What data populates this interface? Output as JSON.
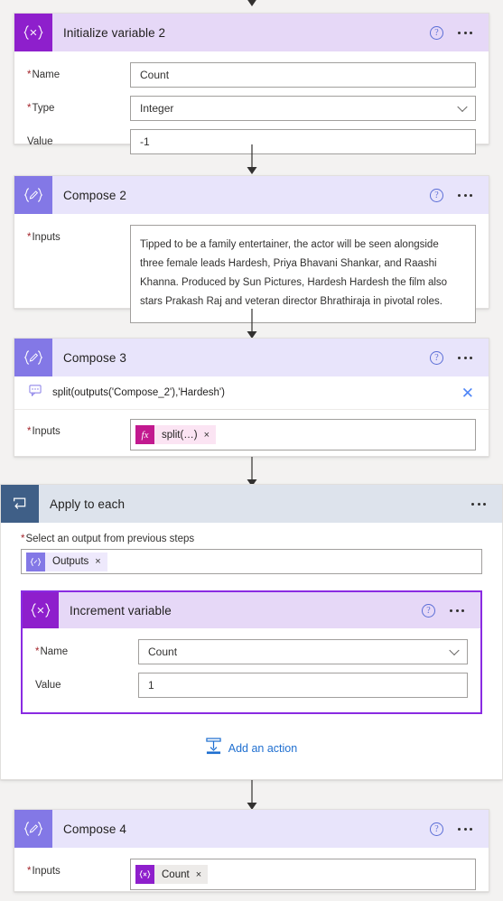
{
  "theme": {
    "bg": "#f3f2f1",
    "variable_purple": "#8e1fcc",
    "compose_purple": "#8378e6",
    "loop_blue": "#3f5f87",
    "accent_link": "#1f6fd0",
    "selected_border": "#8a2be2",
    "required_red": "#a4262c"
  },
  "steps": {
    "initialize_variable": {
      "title": "Initialize variable 2",
      "icon": "variable-icon",
      "fields": [
        {
          "label": "Name",
          "required": true,
          "value": "Count",
          "type": "text"
        },
        {
          "label": "Type",
          "required": true,
          "value": "Integer",
          "type": "dropdown"
        },
        {
          "label": "Value",
          "required": false,
          "value": "-1",
          "type": "text"
        }
      ]
    },
    "compose_2": {
      "title": "Compose 2",
      "icon": "compose-icon",
      "inputs_label": "Inputs",
      "inputs_required": true,
      "inputs_value": "Tipped to be a family entertainer, the actor will be seen alongside three female leads Hardesh, Priya Bhavani Shankar, and Raashi Khanna. Produced by Sun Pictures, Hardesh Hardesh the film also stars Prakash Raj and veteran director Bhrathiraja in pivotal roles."
    },
    "compose_3": {
      "title": "Compose 3",
      "icon": "compose-icon",
      "expression": "split(outputs('Compose_2'),'Hardesh')",
      "expression_icon": "tooltip-icon",
      "close_label": "✕",
      "inputs_label": "Inputs",
      "inputs_required": true,
      "token": {
        "tile": "fx",
        "label": "split(…)",
        "remove": "×"
      }
    },
    "apply_to_each": {
      "title": "Apply to each",
      "icon": "loop-icon",
      "select_label": "Select an output from previous steps",
      "select_required": true,
      "token": {
        "tile": "{/}",
        "label": "Outputs",
        "remove": "×"
      },
      "add_action_label": "Add an action",
      "add_action_icon": "insert-action-icon",
      "nested": {
        "title": "Increment variable",
        "icon": "variable-icon",
        "fields": [
          {
            "label": "Name",
            "required": true,
            "value": "Count",
            "type": "dropdown"
          },
          {
            "label": "Value",
            "required": false,
            "value": "1",
            "type": "text"
          }
        ]
      }
    },
    "compose_4": {
      "title": "Compose 4",
      "icon": "compose-icon",
      "inputs_label": "Inputs",
      "inputs_required": true,
      "token": {
        "tile": "{x}",
        "label": "Count",
        "remove": "×"
      }
    }
  },
  "icons": {
    "help": "?",
    "ellipsis": "…"
  }
}
